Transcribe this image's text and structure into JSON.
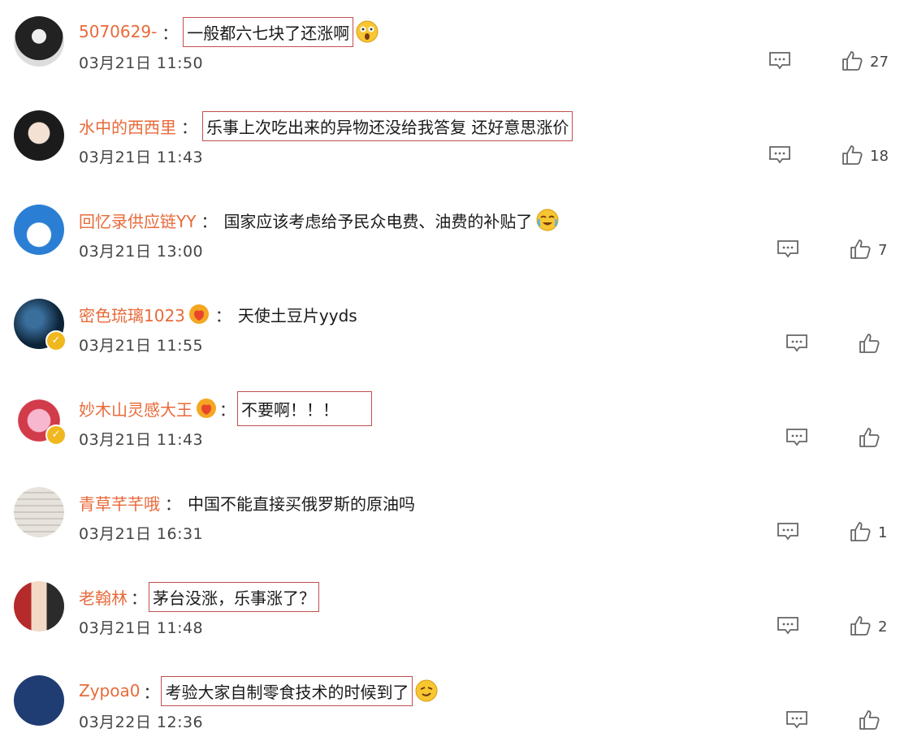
{
  "comments": [
    {
      "username": "5070629-",
      "sep": "：",
      "text": "一般都六七块了还涨啊",
      "time": "03月21日 11:50",
      "likes": "27",
      "emoji": "shocked-face"
    },
    {
      "username": "水中的西西里",
      "sep": "：",
      "text": "乐事上次吃出来的异物还没给我答复 还好意思涨价",
      "time": "03月21日 11:43",
      "likes": "18"
    },
    {
      "username": "回忆录供应链YY",
      "sep": "：",
      "text": "国家应该考虑给予民众电费、油费的补贴了",
      "time": "03月21日 13:00",
      "likes": "7",
      "emoji": "crying-face"
    },
    {
      "username": "密色琉璃1023",
      "sep": "：",
      "text": "天使土豆片yyds",
      "time": "03月21日 11:55",
      "likes": "",
      "badge": "fan-badge",
      "verified": true
    },
    {
      "username": "妙木山灵感大王",
      "sep": "：",
      "text": "不要啊！！！",
      "time": "03月21日 11:43",
      "likes": "",
      "badge": "fan-badge",
      "verified": true
    },
    {
      "username": "青草芊芊哦",
      "sep": "：",
      "text": "中国不能直接买俄罗斯的原油吗",
      "time": "03月21日 16:31",
      "likes": "1"
    },
    {
      "username": "老翰林",
      "sep": "：",
      "text": "茅台没涨，乐事涨了？",
      "time": "03月21日 11:48",
      "likes": "2"
    },
    {
      "username": "Zypoa0",
      "sep": "：",
      "text": "考验大家自制零食技术的时候到了",
      "time": "03月22日 12:36",
      "likes": "",
      "emoji": "sly-face"
    }
  ],
  "colors": {
    "username": "#e86a3a",
    "highlight_box": "#c0504d",
    "verified": "#f0b81e"
  },
  "icons": {
    "reply": "comment-icon",
    "like": "thumbs-up-icon"
  }
}
